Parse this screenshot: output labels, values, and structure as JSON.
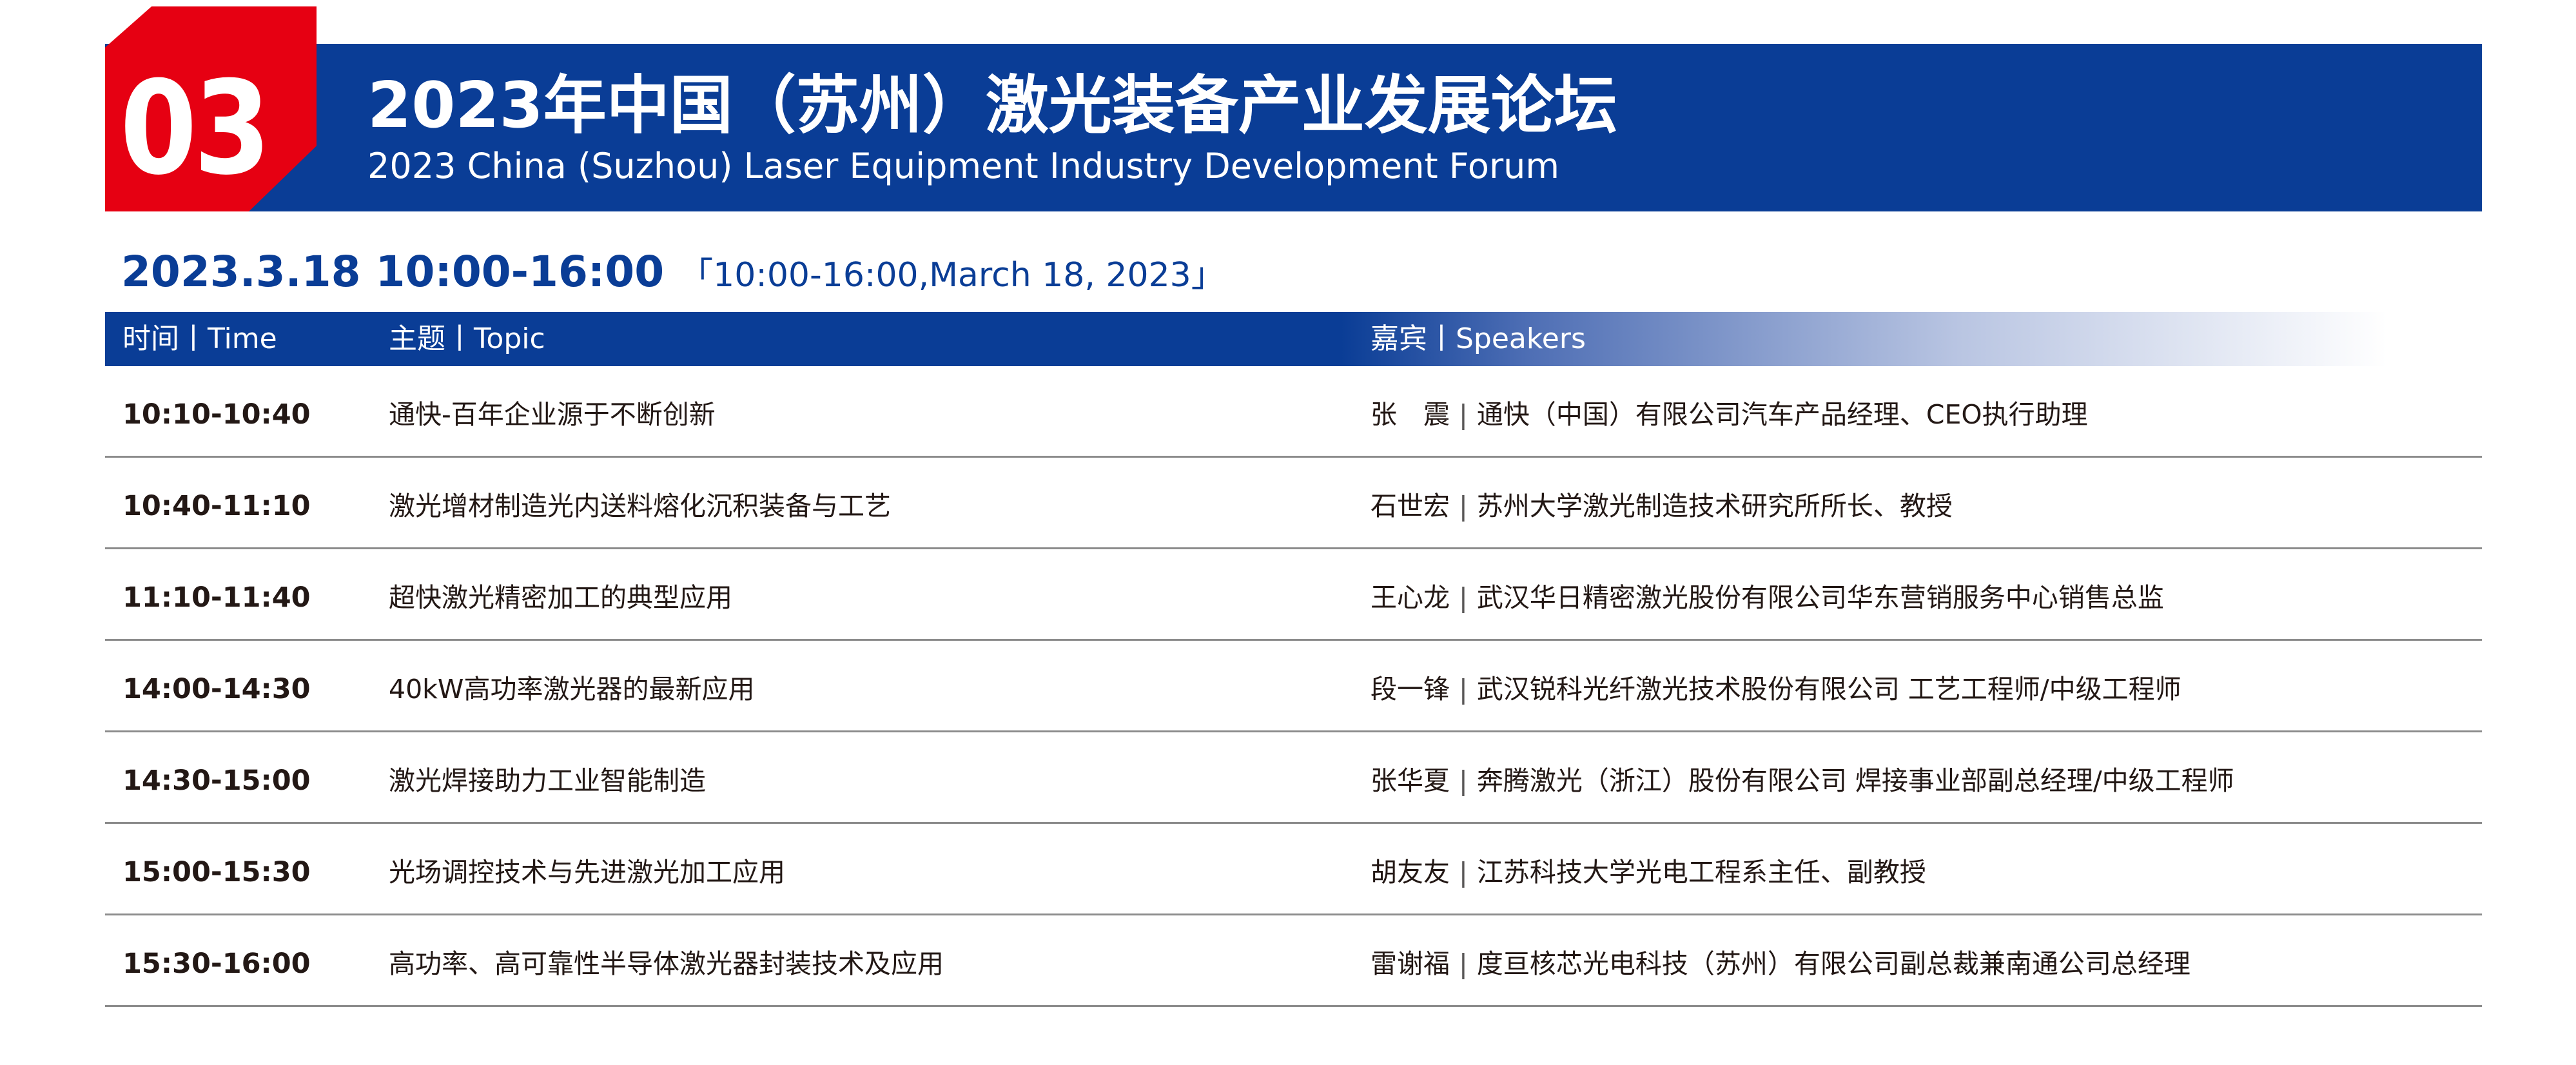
{
  "badge": {
    "number": "03"
  },
  "title": {
    "cn": "2023年中国（苏州）激光装备产业发展论坛",
    "en": "2023 China (Suzhou) Laser Equipment Industry Development Forum"
  },
  "date": {
    "main": "2023.3.18  10:00-16:00",
    "sub": "「10:00-16:00,March 18, 2023」"
  },
  "table": {
    "headers": {
      "time": "时间丨Time",
      "topic": "主题丨Topic",
      "speakers": "嘉宾丨Speakers"
    },
    "separator": "|",
    "rows": [
      {
        "time": "10:10-10:40",
        "topic": "通快-百年企业源于不断创新",
        "speaker": "张　震",
        "affiliation": "通快（中国）有限公司汽车产品经理、CEO执行助理"
      },
      {
        "time": "10:40-11:10",
        "topic": "激光增材制造光内送料熔化沉积装备与工艺",
        "speaker": "石世宏",
        "affiliation": "苏州大学激光制造技术研究所所长、教授"
      },
      {
        "time": "11:10-11:40",
        "topic": "超快激光精密加工的典型应用",
        "speaker": "王心龙",
        "affiliation": "武汉华日精密激光股份有限公司华东营销服务中心销售总监"
      },
      {
        "time": "14:00-14:30",
        "topic": "40kW高功率激光器的最新应用",
        "speaker": "段一锋",
        "affiliation": "武汉锐科光纤激光技术股份有限公司 工艺工程师/中级工程师"
      },
      {
        "time": "14:30-15:00",
        "topic": "激光焊接助力工业智能制造",
        "speaker": "张华夏",
        "affiliation": "奔腾激光（浙江）股份有限公司 焊接事业部副总经理/中级工程师"
      },
      {
        "time": "15:00-15:30",
        "topic": "光场调控技术与先进激光加工应用",
        "speaker": "胡友友",
        "affiliation": "江苏科技大学光电工程系主任、副教授"
      },
      {
        "time": "15:30-16:00",
        "topic": "高功率、高可靠性半导体激光器封装技术及应用",
        "speaker": "雷谢福",
        "affiliation": "度亘核芯光电科技（苏州）有限公司副总裁兼南通公司总经理"
      }
    ]
  },
  "colors": {
    "brand_blue": "#0a3d96",
    "badge_red": "#e60012",
    "rule_gray": "#8c8c8c"
  }
}
